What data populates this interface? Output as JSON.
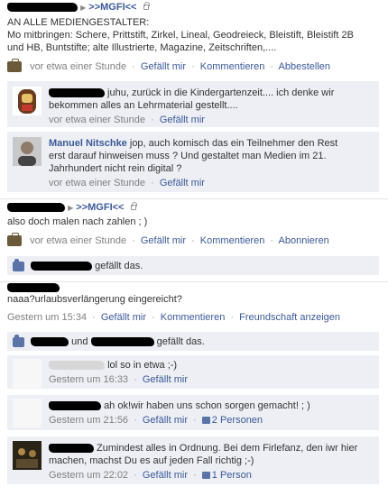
{
  "post1": {
    "target": ">>MGFI<<",
    "text_lines": [
      "AN ALLE MEDIENGESTALTER:",
      "Mo mitbringen: Schere, Prittstift, Zirkel, Lineal, Geodreieck, Bleistift, Bleistift 2B",
      "und HB, Buntstifte; alte Illustrierte, Magazine, Zeitschriften,...."
    ],
    "time": "vor etwa einer Stunde",
    "like": "Gefällt mir",
    "comment": "Kommentieren",
    "action": "Abbestellen",
    "comments": [
      {
        "text1": " juhu, zurück in die Kindergartenzeit.... ich denke wir",
        "text2": "bekommen alles an Lehrmaterial gestellt....",
        "time": "vor etwa einer Stunde",
        "like": "Gefällt mir"
      },
      {
        "name": "Manuel Nitschke",
        "text1": " jop, auch komisch das ein Teilnehmer den Rest",
        "text2": "erst darauf hinweisen muss ? Und gestaltet man Medien im 21.",
        "text3": "Jahrhundert nicht rein digital ?",
        "time": "vor etwa einer Stunde",
        "like": "Gefällt mir"
      }
    ]
  },
  "post2": {
    "target": ">>MGFI<<",
    "text": "also doch malen nach zahlen ; )",
    "time": "vor etwa einer Stunde",
    "like": "Gefällt mir",
    "comment": "Kommentieren",
    "action": "Abonnieren",
    "likes_text": "gefällt das."
  },
  "post3": {
    "text": "naaa?urlaubsverlängerung eingereicht?",
    "time": "Gestern um 15:34",
    "like": "Gefällt mir",
    "comment": "Kommentieren",
    "action": "Freundschaft anzeigen",
    "likes_and": "und",
    "likes_text": "gefällt das.",
    "comments": [
      {
        "text": "lol so in etwa ;-)",
        "time": "Gestern um 16:33",
        "like": "Gefällt mir"
      },
      {
        "text": "ah ok!wir haben uns schon sorgen gemacht! ; )",
        "time": "Gestern um 21:56",
        "like": "Gefällt mir",
        "count": "2 Personen"
      },
      {
        "text1": " Zumindest alles in Ordnung. Bei dem Firlefanz, den iwr hier",
        "text2": "machen, machst Du es auf jeden Fall richtig ;-)",
        "time": "Gestern um 22:02",
        "like": "Gefällt mir",
        "count": "1 Person"
      }
    ]
  },
  "icons": {
    "arrow": "▶",
    "separator": "·",
    "lock": "lock-icon",
    "briefcase": "briefcase-icon",
    "thumb": "thumbs-up-icon"
  },
  "colors": {
    "link": "#3b5998",
    "comment_bg": "#edeff4",
    "meta": "#808080"
  }
}
